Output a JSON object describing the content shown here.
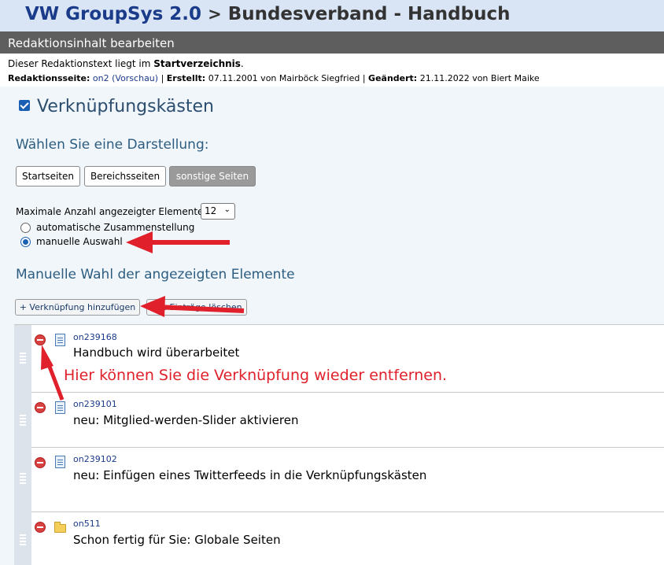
{
  "header": {
    "brand": "VW GroupSys 2.0",
    "separator": ">",
    "page": "Bundesverband - Handbuch"
  },
  "section_bar": {
    "title": "Redaktionsinhalt bearbeiten"
  },
  "info": {
    "location_prefix": "Dieser Redaktionstext liegt im",
    "location": "Startverzeichnis",
    "location_suffix": ".",
    "page_label": "Redaktionsseite:",
    "page_value": "on2 (Vorschau)",
    "created_label": "Erstellt:",
    "created_value": "07.11.2001 von Mairböck Siegfried",
    "changed_label": "Geändert:",
    "changed_value": "21.11.2022 von Biert Maike",
    "sep": "|"
  },
  "module": {
    "title": "Verknüpfungskästen",
    "checked": true
  },
  "display": {
    "heading": "Wählen Sie eine Darstellung:",
    "buttons": [
      "Startseiten",
      "Bereichsseiten",
      "sonstige Seiten"
    ],
    "active": "sonstige Seiten"
  },
  "max_elements": {
    "label": "Maximale Anzahl angezeigter Elemente:",
    "value": "12"
  },
  "mode": {
    "options": [
      "automatische Zusammenstellung",
      "manuelle Auswahl"
    ],
    "selected": "manuelle Auswahl"
  },
  "manual": {
    "heading": "Manuelle Wahl der angezeigten Elemente",
    "add_button": "+ Verknüpfung hinzufügen",
    "clear_button_visible": "alle Einträge löschen"
  },
  "items": [
    {
      "id": "on239168",
      "title": "Handbuch wird überarbeitet",
      "type": "document"
    },
    {
      "id": "on239101",
      "title": "neu: Mitglied-werden-Slider aktivieren",
      "type": "document"
    },
    {
      "id": "on239102",
      "title": "neu: Einfügen eines Twitterfeeds in die Verknüpfungskästen",
      "type": "document"
    },
    {
      "id": "on511",
      "title": "Schon fertig für Sie: Globale Seiten",
      "type": "folder"
    }
  ],
  "annotation": {
    "text": "Hier können Sie die Verknüpfung wieder entfernen."
  },
  "colors": {
    "accent": "#1a3a8a",
    "annotation": "#e0202a",
    "section_bar": "#5e5e5e"
  }
}
